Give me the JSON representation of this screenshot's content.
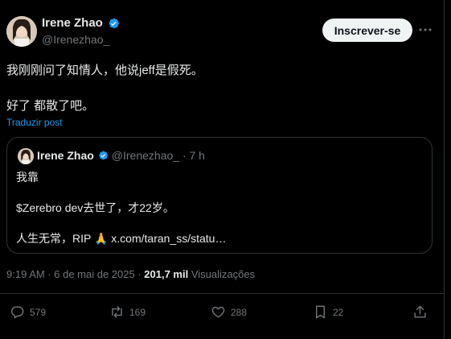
{
  "author": {
    "display_name": "Irene Zhao",
    "handle": "@Irenezhao_",
    "verified": true
  },
  "subscribe_button": "Inscrever-se",
  "post": {
    "line1": "我刚刚问了知情人，他说jeff是假死。",
    "line2": "好了 都散了吧。",
    "translate": "Traduzir post"
  },
  "quote": {
    "display_name": "Irene Zhao",
    "meta": "@Irenezhao_ · 7 h",
    "line1": "我靠",
    "line2": "$Zerebro dev去世了，才22岁。",
    "line3": "人生无常，RIP 🙏 x.com/taran_ss/statu…"
  },
  "meta": {
    "timestamp": "9:19 AM · 6 de mai de 2025 · ",
    "views_count": "201,7 mil",
    "views_label": " Visualizações"
  },
  "actions": {
    "replies": "579",
    "reposts": "169",
    "likes": "288",
    "bookmarks": "22"
  },
  "colors": {
    "background": "#000000",
    "text": "#e7e9ea",
    "muted": "#71767b",
    "accent": "#1d9bf0",
    "border": "#2f3336"
  },
  "icons": [
    "verified-badge-icon",
    "more-icon",
    "reply-icon",
    "repost-icon",
    "like-icon",
    "bookmark-icon",
    "share-icon"
  ]
}
